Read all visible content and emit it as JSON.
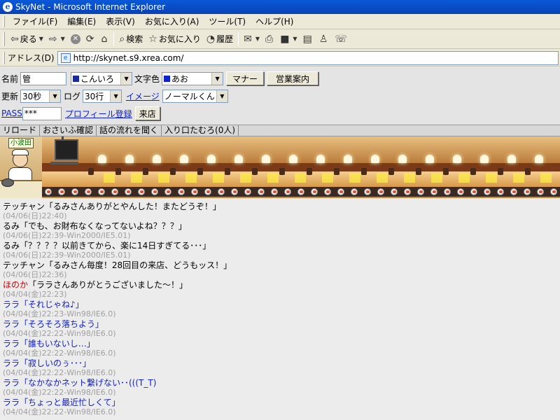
{
  "window": {
    "title": "SkyNet - Microsoft Internet Explorer"
  },
  "menu": [
    "ファイル(F)",
    "編集(E)",
    "表示(V)",
    "お気に入り(A)",
    "ツール(T)",
    "ヘルプ(H)"
  ],
  "toolbar": {
    "back": "戻る",
    "search": "検索",
    "favorites": "お気に入り",
    "history": "履歴"
  },
  "address": {
    "label": "アドレス(D)",
    "url": "http://skynet.s9.xrea.com/"
  },
  "form": {
    "name_label": "名前",
    "name_value": "管",
    "color_select": "こんいろ",
    "color_swatch": "#1a2a9a",
    "text_color_label": "文字色",
    "text_color_select": "あお",
    "text_color_swatch": "#1020cc",
    "manner_button": "マナー",
    "business_button": "営業案内",
    "refresh_label": "更新",
    "refresh_value": "30秒",
    "log_label": "ログ",
    "log_value": "30行",
    "image_link": "イメージ",
    "image_select": "ノーマルくん",
    "pass_link": "PASS",
    "pass_value": "***",
    "profile_link": "プロフィール登録",
    "enter_button": "来店"
  },
  "actions": [
    "リロード",
    "おさいふ確認",
    "話の流れを聞く",
    "入り口たむろ(0人)"
  ],
  "banner": {
    "chef_name": "小波田"
  },
  "messages": [
    {
      "text": "テッチャン「るみさんありがとやんした！またどうぞ！」",
      "meta": "(04/06(日)22:40)",
      "color": "black"
    },
    {
      "text": "るみ「でも、お財布なくなってないよね？？？」",
      "meta": "(04/06(日)22:39-Win2000/IE5.01)",
      "color": "black"
    },
    {
      "text": "るみ「？？？？以前きてから、楽に14日すぎてる･･･」",
      "meta": "(04/06(日)22:39-Win2000/IE5.01)",
      "color": "black"
    },
    {
      "text": "テッチャン「るみさん毎度！28回目の来店、どうもッス！」",
      "meta": "(04/06(日)22:36)",
      "color": "black"
    },
    {
      "name": "ほのか",
      "text": "「ララさんありがとうございました～！」",
      "meta": "(04/04(金)22:23)",
      "color": "red"
    },
    {
      "text": "ララ「それじゃね♪」",
      "meta": "(04/04(金)22:23-Win98/IE6.0)",
      "color": "blue"
    },
    {
      "text": "ララ「そろそろ落ちよう」",
      "meta": "(04/04(金)22:22-Win98/IE6.0)",
      "color": "blue"
    },
    {
      "text": "ララ「誰もいないし…」",
      "meta": "(04/04(金)22:22-Win98/IE6.0)",
      "color": "blue"
    },
    {
      "text": "ララ「寂しいのぅ･･･」",
      "meta": "(04/04(金)22:22-Win98/IE6.0)",
      "color": "blue"
    },
    {
      "text": "ララ「なかなかネット繋げない･･(((T_T)",
      "meta": "(04/04(金)22:22-Win98/IE6.0)",
      "color": "blue"
    },
    {
      "text": "ララ「ちょっと最近忙しくて」",
      "meta": "(04/04(金)22:22-Win98/IE6.0)",
      "color": "blue"
    }
  ]
}
